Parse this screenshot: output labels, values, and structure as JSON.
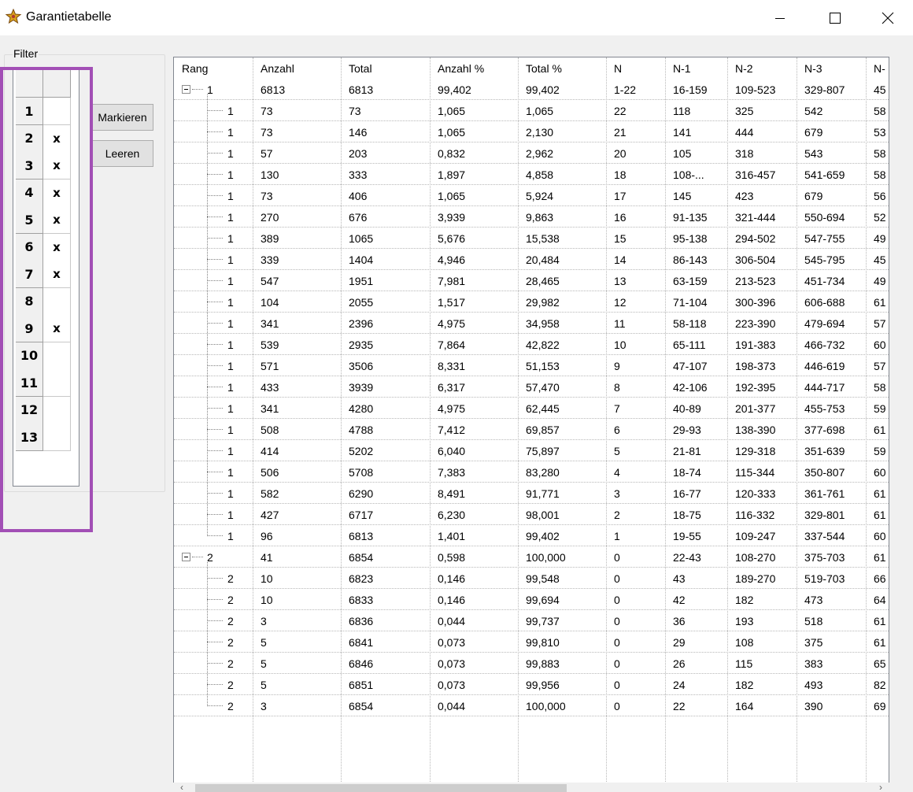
{
  "window": {
    "title": "Garantietabelle"
  },
  "icons": {
    "app": "app-icon",
    "minimize": "minimize-icon",
    "maximize": "maximize-icon",
    "close": "close-icon",
    "expander": "collapse-icon",
    "scroll_left": "chevron-left-icon",
    "scroll_right": "chevron-right-icon"
  },
  "colors": {
    "highlight": "#a24fb5",
    "window_bg": "#f0f0f0"
  },
  "filter": {
    "title": "Filter",
    "rows": [
      {
        "label": "1",
        "mark": ""
      },
      {
        "label": "2",
        "mark": "x"
      },
      {
        "label": "3",
        "mark": "x"
      },
      {
        "label": "4",
        "mark": "x"
      },
      {
        "label": "5",
        "mark": "x"
      },
      {
        "label": "6",
        "mark": "x"
      },
      {
        "label": "7",
        "mark": "x"
      },
      {
        "label": "8",
        "mark": ""
      },
      {
        "label": "9",
        "mark": "x"
      },
      {
        "label": "10",
        "mark": ""
      },
      {
        "label": "11",
        "mark": ""
      },
      {
        "label": "12",
        "mark": ""
      },
      {
        "label": "13",
        "mark": ""
      }
    ]
  },
  "buttons": {
    "markieren": "Markieren",
    "leeren": "Leeren"
  },
  "table": {
    "columns": [
      "Rang",
      "Anzahl",
      "Total",
      "Anzahl %",
      "Total %",
      "N",
      "N-1",
      "N-2",
      "N-3",
      "N-"
    ],
    "rows": [
      {
        "level": 0,
        "rang": "1",
        "anzahl": "6813",
        "total": "6813",
        "anzahl_pct": "99,402",
        "total_pct": "99,402",
        "n": "1-22",
        "n1": "16-159",
        "n2": "109-523",
        "n3": "329-807",
        "n4": "45"
      },
      {
        "level": 1,
        "rang": "1",
        "anzahl": "73",
        "total": "73",
        "anzahl_pct": "1,065",
        "total_pct": "1,065",
        "n": "22",
        "n1": "118",
        "n2": "325",
        "n3": "542",
        "n4": "58"
      },
      {
        "level": 1,
        "rang": "1",
        "anzahl": "73",
        "total": "146",
        "anzahl_pct": "1,065",
        "total_pct": "2,130",
        "n": "21",
        "n1": "141",
        "n2": "444",
        "n3": "679",
        "n4": "53"
      },
      {
        "level": 1,
        "rang": "1",
        "anzahl": "57",
        "total": "203",
        "anzahl_pct": "0,832",
        "total_pct": "2,962",
        "n": "20",
        "n1": "105",
        "n2": "318",
        "n3": "543",
        "n4": "58"
      },
      {
        "level": 1,
        "rang": "1",
        "anzahl": "130",
        "total": "333",
        "anzahl_pct": "1,897",
        "total_pct": "4,858",
        "n": "18",
        "n1": "108-...",
        "n2": "316-457",
        "n3": "541-659",
        "n4": "58"
      },
      {
        "level": 1,
        "rang": "1",
        "anzahl": "73",
        "total": "406",
        "anzahl_pct": "1,065",
        "total_pct": "5,924",
        "n": "17",
        "n1": "145",
        "n2": "423",
        "n3": "679",
        "n4": "56"
      },
      {
        "level": 1,
        "rang": "1",
        "anzahl": "270",
        "total": "676",
        "anzahl_pct": "3,939",
        "total_pct": "9,863",
        "n": "16",
        "n1": "91-135",
        "n2": "321-444",
        "n3": "550-694",
        "n4": "52"
      },
      {
        "level": 1,
        "rang": "1",
        "anzahl": "389",
        "total": "1065",
        "anzahl_pct": "5,676",
        "total_pct": "15,538",
        "n": "15",
        "n1": "95-138",
        "n2": "294-502",
        "n3": "547-755",
        "n4": "49"
      },
      {
        "level": 1,
        "rang": "1",
        "anzahl": "339",
        "total": "1404",
        "anzahl_pct": "4,946",
        "total_pct": "20,484",
        "n": "14",
        "n1": "86-143",
        "n2": "306-504",
        "n3": "545-795",
        "n4": "45"
      },
      {
        "level": 1,
        "rang": "1",
        "anzahl": "547",
        "total": "1951",
        "anzahl_pct": "7,981",
        "total_pct": "28,465",
        "n": "13",
        "n1": "63-159",
        "n2": "213-523",
        "n3": "451-734",
        "n4": "49"
      },
      {
        "level": 1,
        "rang": "1",
        "anzahl": "104",
        "total": "2055",
        "anzahl_pct": "1,517",
        "total_pct": "29,982",
        "n": "12",
        "n1": "71-104",
        "n2": "300-396",
        "n3": "606-688",
        "n4": "61"
      },
      {
        "level": 1,
        "rang": "1",
        "anzahl": "341",
        "total": "2396",
        "anzahl_pct": "4,975",
        "total_pct": "34,958",
        "n": "11",
        "n1": "58-118",
        "n2": "223-390",
        "n3": "479-694",
        "n4": "57"
      },
      {
        "level": 1,
        "rang": "1",
        "anzahl": "539",
        "total": "2935",
        "anzahl_pct": "7,864",
        "total_pct": "42,822",
        "n": "10",
        "n1": "65-111",
        "n2": "191-383",
        "n3": "466-732",
        "n4": "60"
      },
      {
        "level": 1,
        "rang": "1",
        "anzahl": "571",
        "total": "3506",
        "anzahl_pct": "8,331",
        "total_pct": "51,153",
        "n": "9",
        "n1": "47-107",
        "n2": "198-373",
        "n3": "446-619",
        "n4": "57"
      },
      {
        "level": 1,
        "rang": "1",
        "anzahl": "433",
        "total": "3939",
        "anzahl_pct": "6,317",
        "total_pct": "57,470",
        "n": "8",
        "n1": "42-106",
        "n2": "192-395",
        "n3": "444-717",
        "n4": "58"
      },
      {
        "level": 1,
        "rang": "1",
        "anzahl": "341",
        "total": "4280",
        "anzahl_pct": "4,975",
        "total_pct": "62,445",
        "n": "7",
        "n1": "40-89",
        "n2": "201-377",
        "n3": "455-753",
        "n4": "59"
      },
      {
        "level": 1,
        "rang": "1",
        "anzahl": "508",
        "total": "4788",
        "anzahl_pct": "7,412",
        "total_pct": "69,857",
        "n": "6",
        "n1": "29-93",
        "n2": "138-390",
        "n3": "377-698",
        "n4": "61"
      },
      {
        "level": 1,
        "rang": "1",
        "anzahl": "414",
        "total": "5202",
        "anzahl_pct": "6,040",
        "total_pct": "75,897",
        "n": "5",
        "n1": "21-81",
        "n2": "129-318",
        "n3": "351-639",
        "n4": "59"
      },
      {
        "level": 1,
        "rang": "1",
        "anzahl": "506",
        "total": "5708",
        "anzahl_pct": "7,383",
        "total_pct": "83,280",
        "n": "4",
        "n1": "18-74",
        "n2": "115-344",
        "n3": "350-807",
        "n4": "60"
      },
      {
        "level": 1,
        "rang": "1",
        "anzahl": "582",
        "total": "6290",
        "anzahl_pct": "8,491",
        "total_pct": "91,771",
        "n": "3",
        "n1": "16-77",
        "n2": "120-333",
        "n3": "361-761",
        "n4": "61"
      },
      {
        "level": 1,
        "rang": "1",
        "anzahl": "427",
        "total": "6717",
        "anzahl_pct": "6,230",
        "total_pct": "98,001",
        "n": "2",
        "n1": "18-75",
        "n2": "116-332",
        "n3": "329-801",
        "n4": "61"
      },
      {
        "level": 1,
        "rang": "1",
        "anzahl": "96",
        "total": "6813",
        "anzahl_pct": "1,401",
        "total_pct": "99,402",
        "n": "1",
        "n1": "19-55",
        "n2": "109-247",
        "n3": "337-544",
        "n4": "60"
      },
      {
        "level": 0,
        "rang": "2",
        "anzahl": "41",
        "total": "6854",
        "anzahl_pct": "0,598",
        "total_pct": "100,000",
        "n": "0",
        "n1": "22-43",
        "n2": "108-270",
        "n3": "375-703",
        "n4": "61"
      },
      {
        "level": 1,
        "rang": "2",
        "anzahl": "10",
        "total": "6823",
        "anzahl_pct": "0,146",
        "total_pct": "99,548",
        "n": "0",
        "n1": "43",
        "n2": "189-270",
        "n3": "519-703",
        "n4": "66"
      },
      {
        "level": 1,
        "rang": "2",
        "anzahl": "10",
        "total": "6833",
        "anzahl_pct": "0,146",
        "total_pct": "99,694",
        "n": "0",
        "n1": "42",
        "n2": "182",
        "n3": "473",
        "n4": "64"
      },
      {
        "level": 1,
        "rang": "2",
        "anzahl": "3",
        "total": "6836",
        "anzahl_pct": "0,044",
        "total_pct": "99,737",
        "n": "0",
        "n1": "36",
        "n2": "193",
        "n3": "518",
        "n4": "61"
      },
      {
        "level": 1,
        "rang": "2",
        "anzahl": "5",
        "total": "6841",
        "anzahl_pct": "0,073",
        "total_pct": "99,810",
        "n": "0",
        "n1": "29",
        "n2": "108",
        "n3": "375",
        "n4": "61"
      },
      {
        "level": 1,
        "rang": "2",
        "anzahl": "5",
        "total": "6846",
        "anzahl_pct": "0,073",
        "total_pct": "99,883",
        "n": "0",
        "n1": "26",
        "n2": "115",
        "n3": "383",
        "n4": "65"
      },
      {
        "level": 1,
        "rang": "2",
        "anzahl": "5",
        "total": "6851",
        "anzahl_pct": "0,073",
        "total_pct": "99,956",
        "n": "0",
        "n1": "24",
        "n2": "182",
        "n3": "493",
        "n4": "82"
      },
      {
        "level": 1,
        "rang": "2",
        "anzahl": "3",
        "total": "6854",
        "anzahl_pct": "0,044",
        "total_pct": "100,000",
        "n": "0",
        "n1": "22",
        "n2": "164",
        "n3": "390",
        "n4": "69"
      }
    ]
  }
}
